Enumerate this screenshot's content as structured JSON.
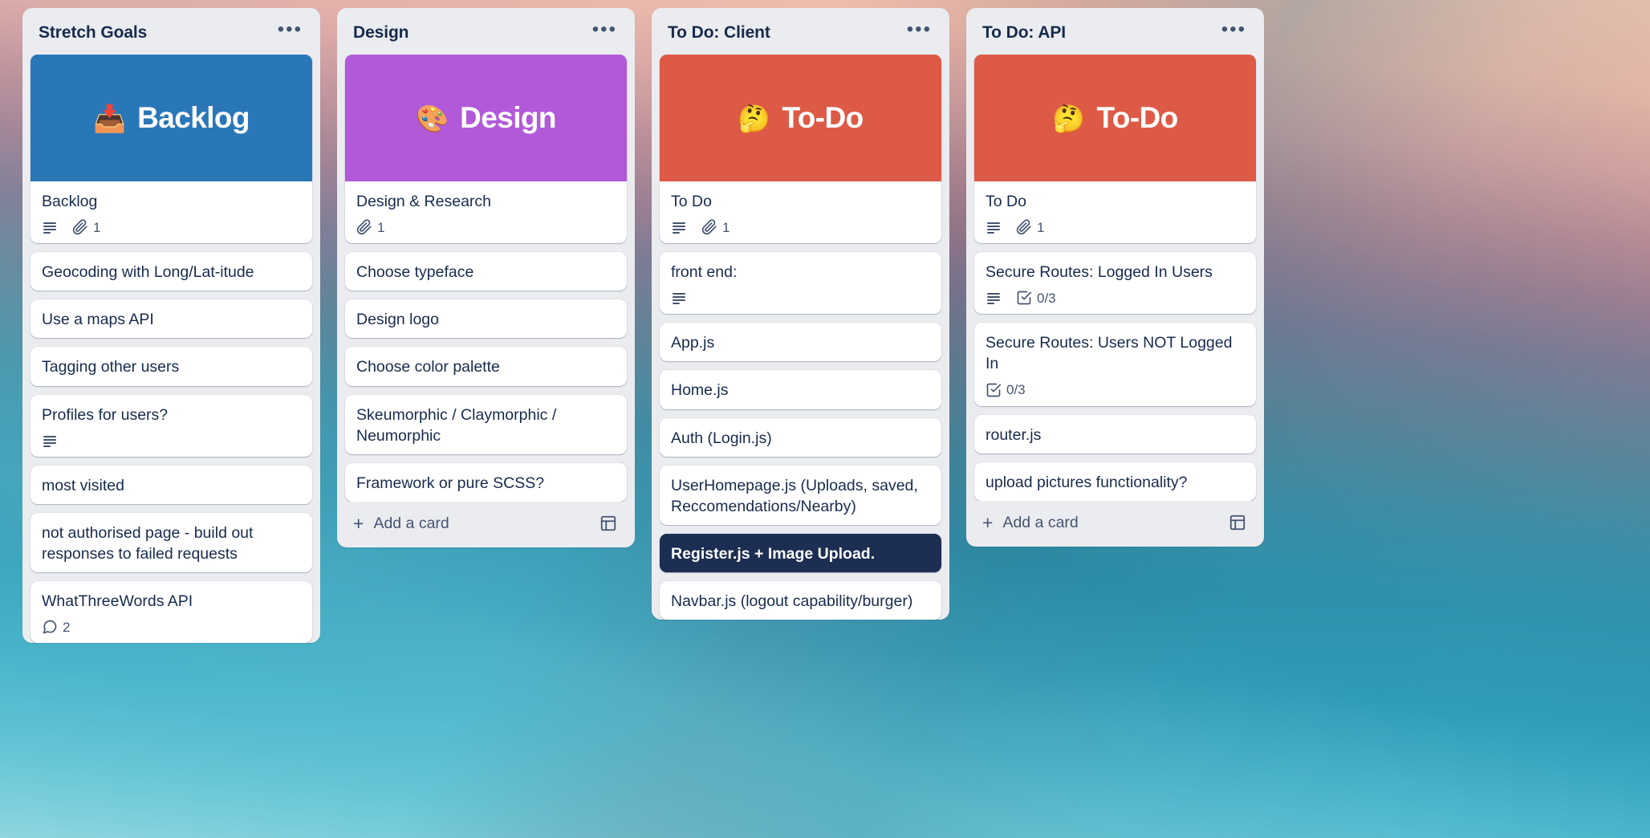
{
  "board": {
    "background_colors": [
      "#f0c0ab",
      "#b98b95",
      "#5f8499",
      "#2f9db8",
      "#8ed6e0"
    ]
  },
  "lists": [
    {
      "title": "Stretch Goals",
      "menu_icon": "ellipsis-icon",
      "cover": {
        "emoji": "📥",
        "emoji_name": "inbox-tray-emoji",
        "text": "Backlog",
        "color": "#2a77b8"
      },
      "cards": [
        {
          "title": "Backlog",
          "has_cover": true,
          "badges": [
            {
              "type": "description",
              "icon": "description-icon",
              "value": ""
            },
            {
              "type": "attachment",
              "icon": "paperclip-icon",
              "value": "1"
            }
          ]
        },
        {
          "title": "Geocoding with Long/Lat-itude",
          "badges": []
        },
        {
          "title": "Use a maps API",
          "badges": []
        },
        {
          "title": "Tagging other users",
          "badges": []
        },
        {
          "title": "Profiles for users?",
          "badges": [
            {
              "type": "description",
              "icon": "description-icon",
              "value": ""
            }
          ]
        },
        {
          "title": "most visited",
          "badges": []
        },
        {
          "title": "not authorised page - build out responses to failed requests",
          "badges": []
        },
        {
          "title": "WhatThreeWords API",
          "badges": [
            {
              "type": "comments",
              "icon": "comment-icon",
              "value": "2"
            }
          ]
        }
      ],
      "footer": null
    },
    {
      "title": "Design",
      "menu_icon": "ellipsis-icon",
      "cover": {
        "emoji": "🎨",
        "emoji_name": "artist-palette-emoji",
        "text": "Design",
        "color": "#b259d9"
      },
      "cards": [
        {
          "title": "Design & Research",
          "has_cover": true,
          "badges": [
            {
              "type": "attachment",
              "icon": "paperclip-icon",
              "value": "1"
            }
          ]
        },
        {
          "title": "Choose typeface",
          "badges": []
        },
        {
          "title": "Design logo",
          "badges": []
        },
        {
          "title": "Choose color palette",
          "badges": []
        },
        {
          "title": "Skeumorphic / Claymorphic / Neumorphic",
          "badges": []
        },
        {
          "title": "Framework or pure SCSS?",
          "badges": []
        }
      ],
      "footer": {
        "add_label": "Add a card",
        "plus_icon": "plus-icon",
        "template_icon": "card-template-icon"
      }
    },
    {
      "title": "To Do: Client",
      "menu_icon": "ellipsis-icon",
      "cover": {
        "emoji": "🤔",
        "emoji_name": "thinking-face-emoji",
        "text": "To-Do",
        "color": "#dd5a46"
      },
      "cards": [
        {
          "title": "To Do",
          "has_cover": true,
          "badges": [
            {
              "type": "description",
              "icon": "description-icon",
              "value": ""
            },
            {
              "type": "attachment",
              "icon": "paperclip-icon",
              "value": "1"
            }
          ]
        },
        {
          "title": "front end:",
          "badges": [
            {
              "type": "description",
              "icon": "description-icon",
              "value": ""
            }
          ]
        },
        {
          "title": "App.js",
          "badges": []
        },
        {
          "title": "Home.js",
          "badges": []
        },
        {
          "title": "Auth (Login.js)",
          "badges": []
        },
        {
          "title": "UserHomepage.js (Uploads, saved, Reccomendations/Nearby)",
          "badges": []
        },
        {
          "title": "Register.js + Image Upload.",
          "badges": [],
          "dark": true,
          "color": "#1c2e52"
        },
        {
          "title": "Navbar.js (logout capability/burger)",
          "badges": []
        }
      ],
      "footer": null
    },
    {
      "title": "To Do: API",
      "menu_icon": "ellipsis-icon",
      "cover": {
        "emoji": "🤔",
        "emoji_name": "thinking-face-emoji",
        "text": "To-Do",
        "color": "#dd5a46"
      },
      "cards": [
        {
          "title": "To Do",
          "has_cover": true,
          "badges": [
            {
              "type": "description",
              "icon": "description-icon",
              "value": ""
            },
            {
              "type": "attachment",
              "icon": "paperclip-icon",
              "value": "1"
            }
          ]
        },
        {
          "title": "Secure Routes: Logged In Users",
          "badges": [
            {
              "type": "description",
              "icon": "description-icon",
              "value": ""
            },
            {
              "type": "checklist",
              "icon": "checklist-icon",
              "value": "0/3"
            }
          ]
        },
        {
          "title": "Secure Routes: Users NOT Logged In",
          "badges": [
            {
              "type": "checklist",
              "icon": "checklist-icon",
              "value": "0/3"
            }
          ]
        },
        {
          "title": "router.js",
          "badges": []
        },
        {
          "title": "upload pictures functionality?",
          "badges": []
        }
      ],
      "footer": {
        "add_label": "Add a card",
        "plus_icon": "plus-icon",
        "template_icon": "card-template-icon"
      }
    }
  ]
}
